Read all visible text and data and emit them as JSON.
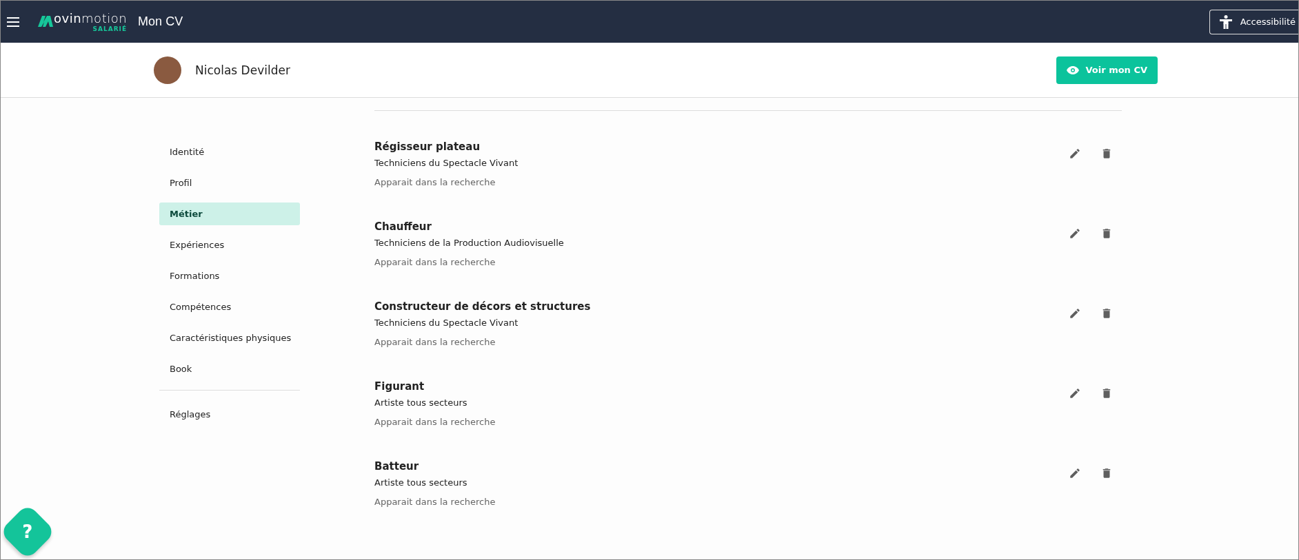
{
  "header": {
    "logo_text": "**ovin**motion",
    "logo_sub": "SALARIÉ",
    "title": "Mon CV",
    "accessibility_button": "Accessibilité"
  },
  "profile": {
    "name": "Nicolas Devilder",
    "view_button": "Voir mon CV"
  },
  "sidebar": {
    "items": [
      {
        "label": "Identité",
        "selected": false
      },
      {
        "label": "Profil",
        "selected": false
      },
      {
        "label": "Métier",
        "selected": true
      },
      {
        "label": "Expériences",
        "selected": false
      },
      {
        "label": "Formations",
        "selected": false
      },
      {
        "label": "Compétences",
        "selected": false
      },
      {
        "label": "Caractéristiques physiques",
        "selected": false
      },
      {
        "label": "Book",
        "selected": false
      }
    ],
    "footer_items": [
      {
        "label": "Réglages",
        "selected": false
      }
    ]
  },
  "jobs": [
    {
      "title": "Régisseur plateau",
      "sector": "Techniciens du Spectacle Vivant",
      "status": "Apparait dans la recherche"
    },
    {
      "title": "Chauffeur",
      "sector": "Techniciens de la Production Audiovisuelle",
      "status": "Apparait dans la recherche"
    },
    {
      "title": "Constructeur de décors et structures",
      "sector": "Techniciens du Spectacle Vivant",
      "status": "Apparait dans la recherche"
    },
    {
      "title": "Figurant",
      "sector": "Artiste tous secteurs",
      "status": "Apparait dans la recherche"
    },
    {
      "title": "Batteur",
      "sector": "Artiste tous secteurs",
      "status": "Apparait dans la recherche"
    }
  ],
  "help_button": "?"
}
